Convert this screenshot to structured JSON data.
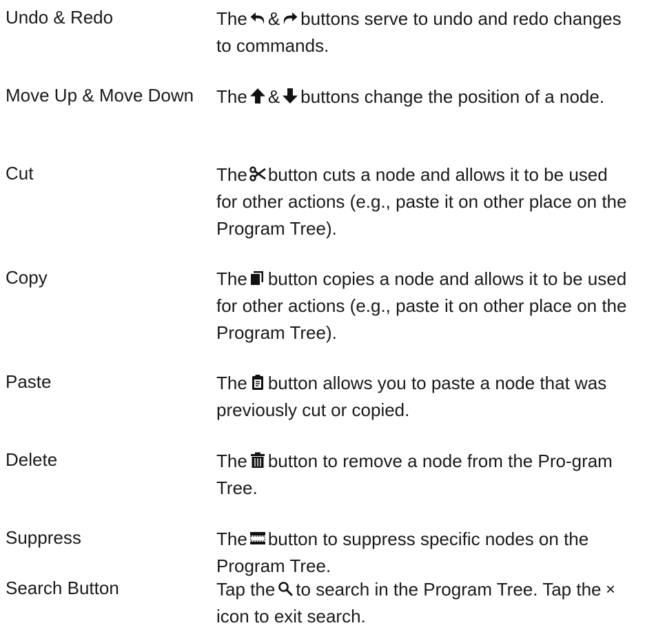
{
  "rows": [
    {
      "term": "Undo & Redo",
      "desc_prefix": "The",
      "desc_mid": "&",
      "desc_suffix": "buttons serve to undo and redo changes to commands.",
      "icons": [
        "undo-icon",
        "redo-icon"
      ]
    },
    {
      "term": "Move Up & Move Down",
      "desc_prefix": "The",
      "desc_mid": "&",
      "desc_suffix": "buttons change the position of a node.",
      "icons": [
        "arrow-up-icon",
        "arrow-down-icon"
      ]
    },
    {
      "term": "Cut",
      "desc_prefix": "The",
      "desc_suffix": "button cuts a node and allows it to be used for other actions (e.g., paste it on other place on the Program Tree).",
      "icons": [
        "scissors-icon"
      ]
    },
    {
      "term": "Copy",
      "desc_prefix": "The",
      "desc_suffix": "button copies a node and allows it to be used for other actions (e.g., paste it on other place on the Program Tree).",
      "icons": [
        "copy-icon"
      ]
    },
    {
      "term": "Paste",
      "desc_prefix": "The",
      "desc_suffix": "button allows you to paste a node that was previously cut or copied.",
      "icons": [
        "paste-icon"
      ]
    },
    {
      "term": "Delete",
      "desc_prefix": "The",
      "desc_suffix": "button to remove a node from the Pro-gram Tree.",
      "icons": [
        "trash-icon"
      ]
    },
    {
      "term": "Suppress",
      "desc_prefix": "The",
      "desc_suffix": "button to suppress specific nodes on the Program Tree.",
      "icons": [
        "suppress-icon"
      ]
    },
    {
      "term": "Search Button",
      "desc_prefix": "Tap the",
      "desc_mid": "to search in the Program Tree. Tap the",
      "desc_suffix": "icon to exit search.",
      "icons": [
        "search-icon",
        "close-icon"
      ]
    }
  ]
}
